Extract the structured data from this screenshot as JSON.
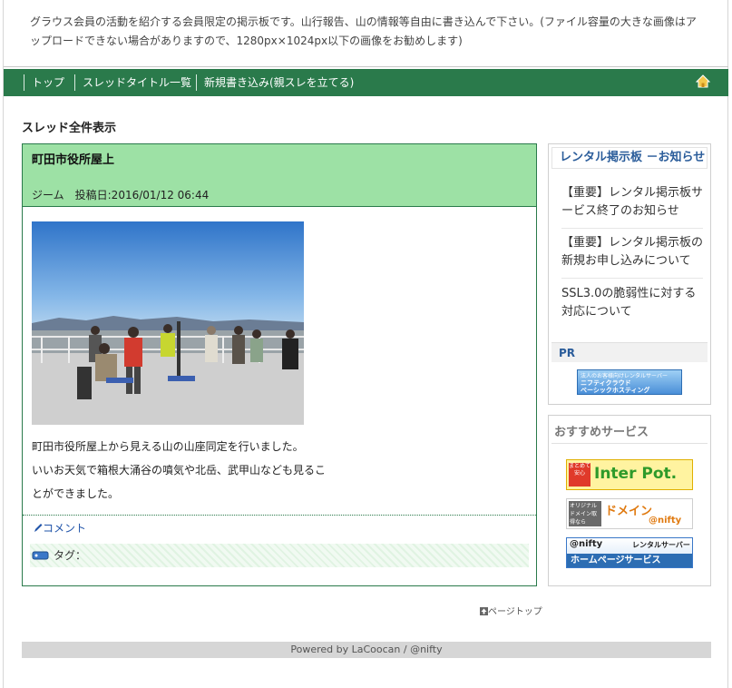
{
  "header": {
    "description": "グラウス会員の活動を紹介する会員限定の掲示板です。山行報告、山の情報等自由に書き込んで下さい。(ファイル容量の大きな画像はアップロードできない場合がありますので、1280px×1024px以下の画像をお勧めします)"
  },
  "nav": {
    "items": [
      {
        "label": "トップ"
      },
      {
        "label": "スレッドタイトル一覧"
      },
      {
        "label": "新規書き込み(親スレを立てる)"
      }
    ],
    "home_icon": "home-icon"
  },
  "section_title": "スレッド全件表示",
  "post": {
    "title": "町田市役所屋上",
    "meta": "ジーム　投稿日:2016/01/12 06:44",
    "body_lines": [
      "町田市役所屋上から見える山の山座同定を行いました。",
      "いいお天気で箱根大涌谷の噴気や北岳、武甲山なども見るこ",
      "とができました。"
    ],
    "comment_label": "コメント",
    "tag_label": "タグ："
  },
  "page_top": "ページトップ",
  "footer": "Powered by LaCoocan / @nifty",
  "sidebar": {
    "notice_title": "レンタル掲示板 －お知らせ",
    "notices": [
      {
        "label": "【重要】レンタル掲示板サービス終了のお知らせ"
      },
      {
        "label": "【重要】レンタル掲示板の新規お申し込みについて"
      },
      {
        "label": "SSL3.0の脆弱性に対する対応について"
      }
    ],
    "pr_title": "PR",
    "pr_banner_lines": [
      "法人のお客様向けレンタルサーバー",
      "ニフティクラウド",
      "ベーシックホスティング"
    ],
    "recommend_title": "おすすめサービス",
    "banners": [
      {
        "line1": "Inter Pot.",
        "line2": "まとめて安心"
      },
      {
        "line1": "オリジナルドメイン取得なら",
        "line2": "ドメイン",
        "line3": "@nifty"
      },
      {
        "line1": "@nifty",
        "line2": "レンタルサーバー",
        "line3": "ホームページサービス"
      }
    ]
  },
  "colors": {
    "nav_bg": "#2a7a4b",
    "post_head_bg": "#9de1a5",
    "link": "#2255aa",
    "footer_bg": "#d6d6d6"
  }
}
